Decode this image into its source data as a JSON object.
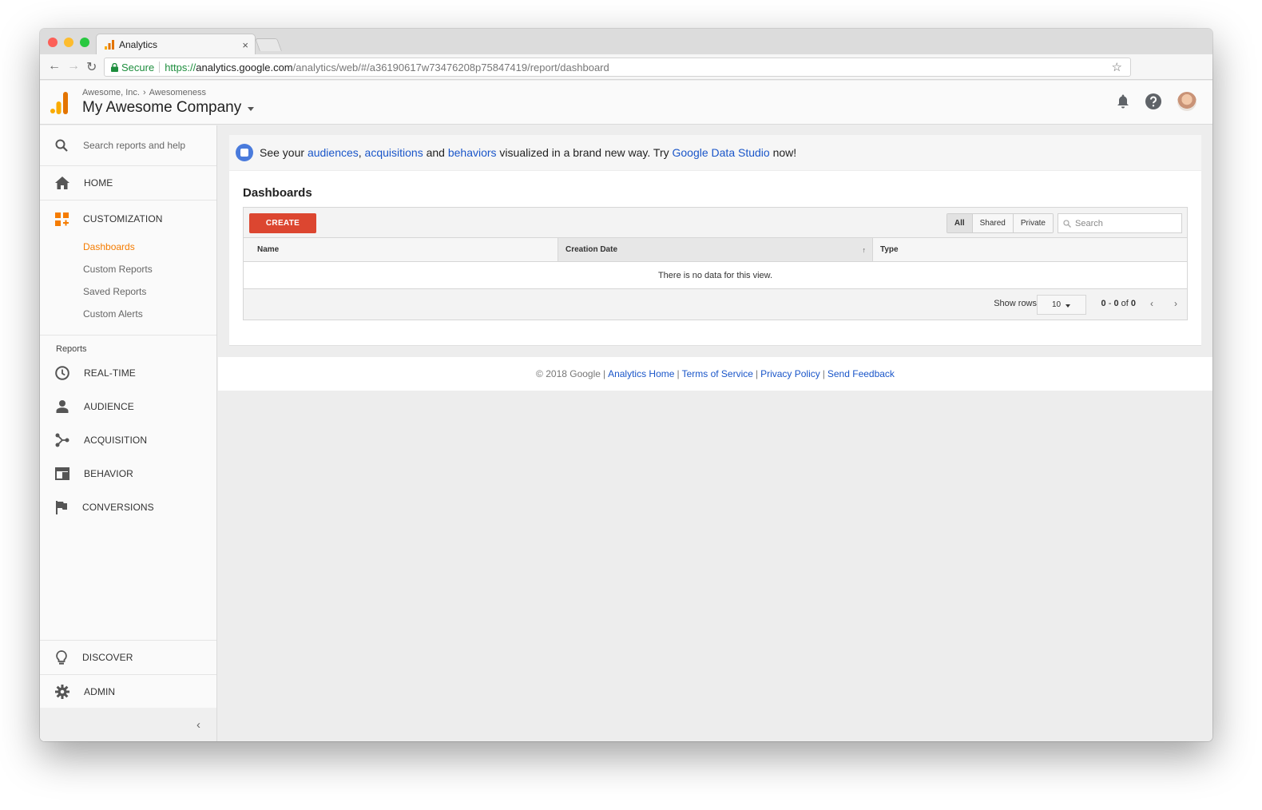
{
  "browser": {
    "tab_title": "Analytics",
    "tab_close": "×",
    "secure_label": "Secure",
    "url_scheme": "https://",
    "url_domain": "analytics.google.com",
    "url_path": "/analytics/web/#/a36190617w73476208p75847419/report/dashboard"
  },
  "header": {
    "breadcrumb_org": "Awesome, Inc.",
    "breadcrumb_sep": "›",
    "breadcrumb_property": "Awesomeness",
    "account_title": "My Awesome Company"
  },
  "sidebar": {
    "search_placeholder": "Search reports and help",
    "home": "HOME",
    "customization": "CUSTOMIZATION",
    "sub_items": [
      "Dashboards",
      "Custom Reports",
      "Saved Reports",
      "Custom Alerts"
    ],
    "reports_heading": "Reports",
    "reports": [
      "REAL-TIME",
      "AUDIENCE",
      "ACQUISITION",
      "BEHAVIOR",
      "CONVERSIONS"
    ],
    "discover": "DISCOVER",
    "admin": "ADMIN",
    "collapse": "‹"
  },
  "banner": {
    "prefix": "See your ",
    "link1": "audiences",
    "comma": ", ",
    "link2": "acquisitions",
    "and": " and ",
    "link3": "behaviors",
    "middle": " visualized in a brand new way. Try ",
    "link4": "Google Data Studio",
    "suffix": " now!"
  },
  "dashboards": {
    "title": "Dashboards",
    "create_label": "CREATE",
    "filters": [
      "All",
      "Shared",
      "Private"
    ],
    "active_filter": "All",
    "search_placeholder": "Search",
    "columns": [
      "Name",
      "Creation Date",
      "Type"
    ],
    "sort_indicator": "↑",
    "empty_message": "There is no data for this view.",
    "show_rows_label": "Show rows",
    "rows_value": "10",
    "range_start": "0",
    "range_dash": " - ",
    "range_end": "0",
    "range_of": " of ",
    "range_total": "0",
    "prev": "‹",
    "next": "›"
  },
  "footer": {
    "copyright": "© 2018 Google",
    "links": [
      "Analytics Home",
      "Terms of Service",
      "Privacy Policy",
      "Send Feedback"
    ],
    "separator": "|"
  },
  "colors": {
    "accent_orange": "#f57c00",
    "create_red": "#dc4630",
    "link_blue": "#1a56c9",
    "secure_green": "#1e8e3e"
  }
}
